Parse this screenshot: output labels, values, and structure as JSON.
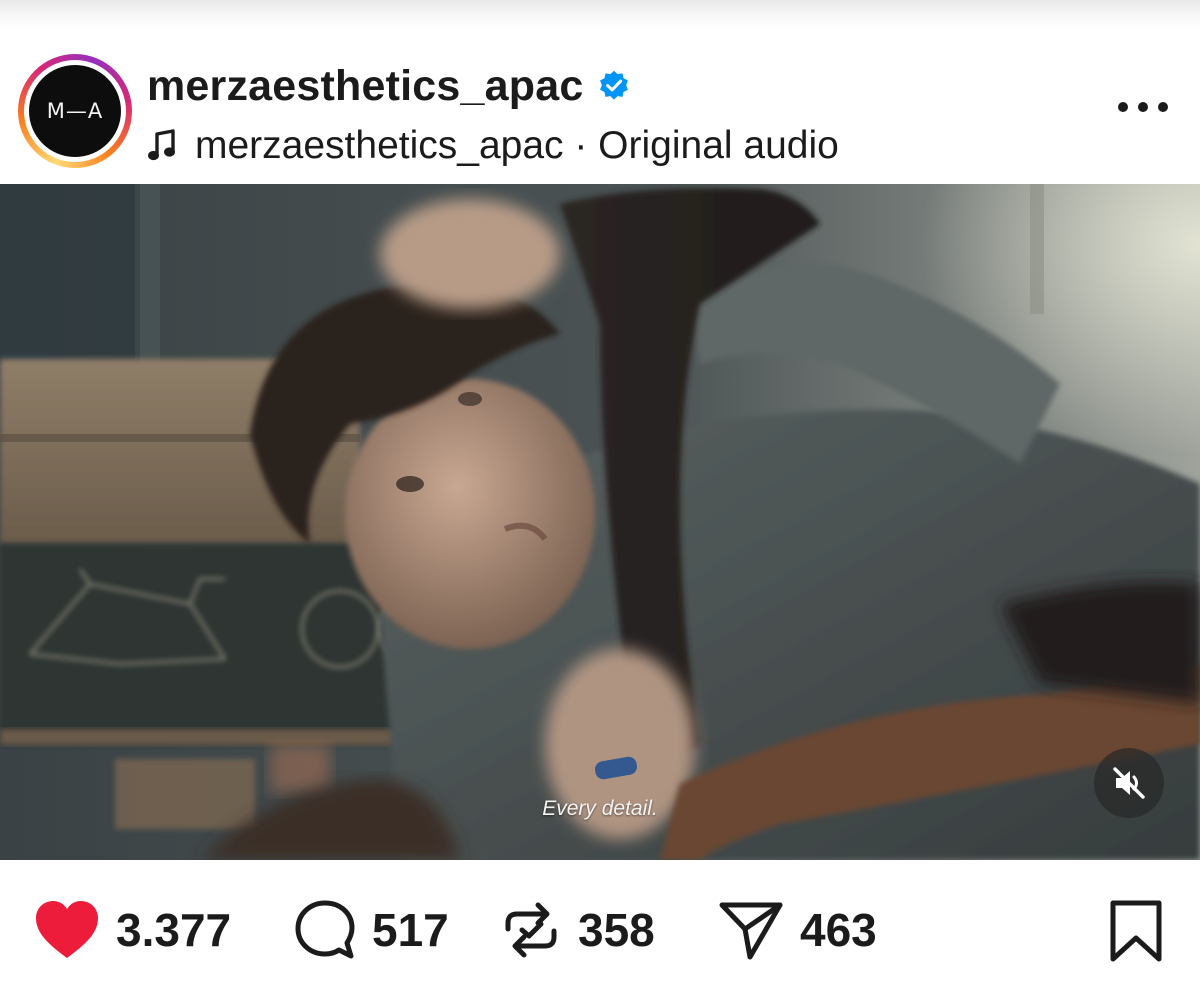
{
  "post": {
    "avatar_text": "M—A",
    "username": "merzaesthetics_apac",
    "audio_label": "merzaesthetics_apac · Original audio",
    "verified": true
  },
  "video": {
    "subtitle": "Every detail.",
    "muted": true
  },
  "actions": {
    "likes": "3.377",
    "comments": "517",
    "reposts": "358",
    "shares": "463",
    "liked": true
  },
  "icons": {
    "more": "more-icon",
    "verified": "verified-badge-icon",
    "audio": "music-note-icon",
    "mute": "speaker-muted-icon",
    "like": "heart-icon",
    "comment": "comment-icon",
    "repost": "repost-icon",
    "share": "send-icon",
    "save": "bookmark-icon"
  },
  "colors": {
    "like_active": "#ed1c3a",
    "verified": "#0095f6",
    "text": "#1b1b1b"
  }
}
